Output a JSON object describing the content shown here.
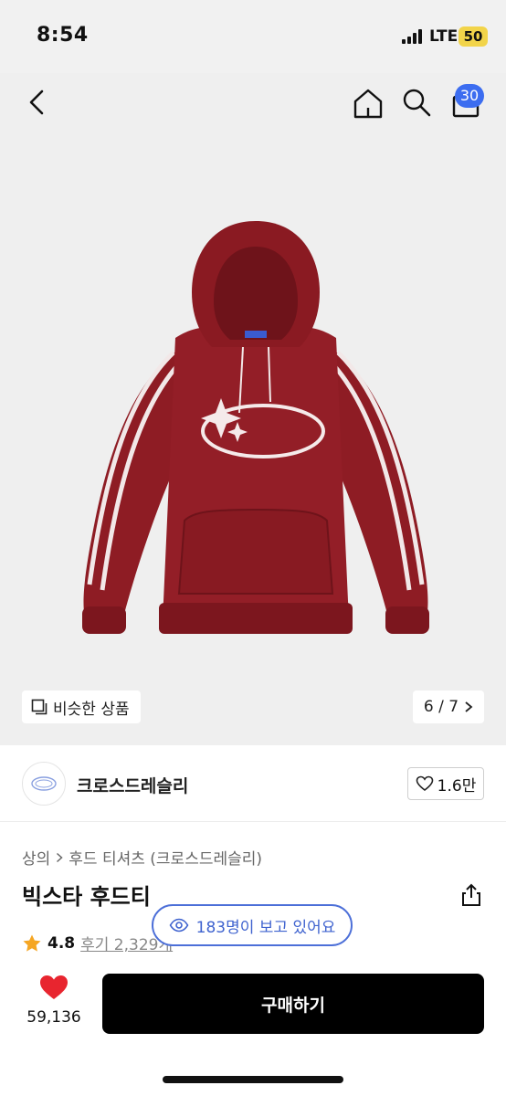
{
  "status_bar": {
    "time": "8:54",
    "network": "LTE",
    "battery": "50"
  },
  "header": {
    "cart_count": "30"
  },
  "gallery": {
    "similar_label": "비슷한 상품",
    "page_indicator": "6 / 7"
  },
  "brand": {
    "name": "크로스드레슬리",
    "likes": "1.6만"
  },
  "breadcrumb": {
    "category": "상의",
    "subcategory": "후드 티셔츠 (크로스드레슬리)"
  },
  "product": {
    "title": "빅스타 후드티",
    "rating": "4.8",
    "reviews": "후기 2,329개",
    "viewers": "183명이 보고 있어요"
  },
  "purchase": {
    "wish_count": "59,136",
    "buy_label": "구매하기"
  },
  "colors": {
    "accent_blue": "#3c6df0",
    "hoodie_red": "#8e1c24",
    "heart_red": "#e8252f",
    "star_yellow": "#f5a623"
  }
}
